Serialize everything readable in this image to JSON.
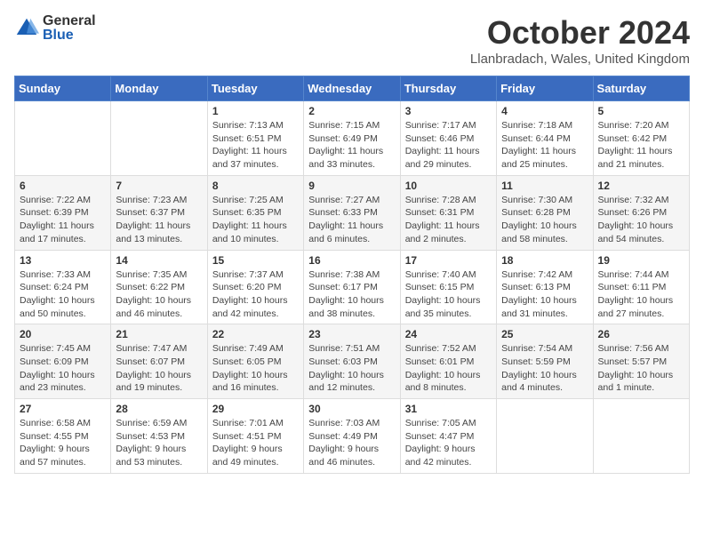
{
  "logo": {
    "general": "General",
    "blue": "Blue"
  },
  "header": {
    "month": "October 2024",
    "location": "Llanbradach, Wales, United Kingdom"
  },
  "weekdays": [
    "Sunday",
    "Monday",
    "Tuesday",
    "Wednesday",
    "Thursday",
    "Friday",
    "Saturday"
  ],
  "weeks": [
    [
      {
        "day": "",
        "sunrise": "",
        "sunset": "",
        "daylight": ""
      },
      {
        "day": "",
        "sunrise": "",
        "sunset": "",
        "daylight": ""
      },
      {
        "day": "1",
        "sunrise": "Sunrise: 7:13 AM",
        "sunset": "Sunset: 6:51 PM",
        "daylight": "Daylight: 11 hours and 37 minutes."
      },
      {
        "day": "2",
        "sunrise": "Sunrise: 7:15 AM",
        "sunset": "Sunset: 6:49 PM",
        "daylight": "Daylight: 11 hours and 33 minutes."
      },
      {
        "day": "3",
        "sunrise": "Sunrise: 7:17 AM",
        "sunset": "Sunset: 6:46 PM",
        "daylight": "Daylight: 11 hours and 29 minutes."
      },
      {
        "day": "4",
        "sunrise": "Sunrise: 7:18 AM",
        "sunset": "Sunset: 6:44 PM",
        "daylight": "Daylight: 11 hours and 25 minutes."
      },
      {
        "day": "5",
        "sunrise": "Sunrise: 7:20 AM",
        "sunset": "Sunset: 6:42 PM",
        "daylight": "Daylight: 11 hours and 21 minutes."
      }
    ],
    [
      {
        "day": "6",
        "sunrise": "Sunrise: 7:22 AM",
        "sunset": "Sunset: 6:39 PM",
        "daylight": "Daylight: 11 hours and 17 minutes."
      },
      {
        "day": "7",
        "sunrise": "Sunrise: 7:23 AM",
        "sunset": "Sunset: 6:37 PM",
        "daylight": "Daylight: 11 hours and 13 minutes."
      },
      {
        "day": "8",
        "sunrise": "Sunrise: 7:25 AM",
        "sunset": "Sunset: 6:35 PM",
        "daylight": "Daylight: 11 hours and 10 minutes."
      },
      {
        "day": "9",
        "sunrise": "Sunrise: 7:27 AM",
        "sunset": "Sunset: 6:33 PM",
        "daylight": "Daylight: 11 hours and 6 minutes."
      },
      {
        "day": "10",
        "sunrise": "Sunrise: 7:28 AM",
        "sunset": "Sunset: 6:31 PM",
        "daylight": "Daylight: 11 hours and 2 minutes."
      },
      {
        "day": "11",
        "sunrise": "Sunrise: 7:30 AM",
        "sunset": "Sunset: 6:28 PM",
        "daylight": "Daylight: 10 hours and 58 minutes."
      },
      {
        "day": "12",
        "sunrise": "Sunrise: 7:32 AM",
        "sunset": "Sunset: 6:26 PM",
        "daylight": "Daylight: 10 hours and 54 minutes."
      }
    ],
    [
      {
        "day": "13",
        "sunrise": "Sunrise: 7:33 AM",
        "sunset": "Sunset: 6:24 PM",
        "daylight": "Daylight: 10 hours and 50 minutes."
      },
      {
        "day": "14",
        "sunrise": "Sunrise: 7:35 AM",
        "sunset": "Sunset: 6:22 PM",
        "daylight": "Daylight: 10 hours and 46 minutes."
      },
      {
        "day": "15",
        "sunrise": "Sunrise: 7:37 AM",
        "sunset": "Sunset: 6:20 PM",
        "daylight": "Daylight: 10 hours and 42 minutes."
      },
      {
        "day": "16",
        "sunrise": "Sunrise: 7:38 AM",
        "sunset": "Sunset: 6:17 PM",
        "daylight": "Daylight: 10 hours and 38 minutes."
      },
      {
        "day": "17",
        "sunrise": "Sunrise: 7:40 AM",
        "sunset": "Sunset: 6:15 PM",
        "daylight": "Daylight: 10 hours and 35 minutes."
      },
      {
        "day": "18",
        "sunrise": "Sunrise: 7:42 AM",
        "sunset": "Sunset: 6:13 PM",
        "daylight": "Daylight: 10 hours and 31 minutes."
      },
      {
        "day": "19",
        "sunrise": "Sunrise: 7:44 AM",
        "sunset": "Sunset: 6:11 PM",
        "daylight": "Daylight: 10 hours and 27 minutes."
      }
    ],
    [
      {
        "day": "20",
        "sunrise": "Sunrise: 7:45 AM",
        "sunset": "Sunset: 6:09 PM",
        "daylight": "Daylight: 10 hours and 23 minutes."
      },
      {
        "day": "21",
        "sunrise": "Sunrise: 7:47 AM",
        "sunset": "Sunset: 6:07 PM",
        "daylight": "Daylight: 10 hours and 19 minutes."
      },
      {
        "day": "22",
        "sunrise": "Sunrise: 7:49 AM",
        "sunset": "Sunset: 6:05 PM",
        "daylight": "Daylight: 10 hours and 16 minutes."
      },
      {
        "day": "23",
        "sunrise": "Sunrise: 7:51 AM",
        "sunset": "Sunset: 6:03 PM",
        "daylight": "Daylight: 10 hours and 12 minutes."
      },
      {
        "day": "24",
        "sunrise": "Sunrise: 7:52 AM",
        "sunset": "Sunset: 6:01 PM",
        "daylight": "Daylight: 10 hours and 8 minutes."
      },
      {
        "day": "25",
        "sunrise": "Sunrise: 7:54 AM",
        "sunset": "Sunset: 5:59 PM",
        "daylight": "Daylight: 10 hours and 4 minutes."
      },
      {
        "day": "26",
        "sunrise": "Sunrise: 7:56 AM",
        "sunset": "Sunset: 5:57 PM",
        "daylight": "Daylight: 10 hours and 1 minute."
      }
    ],
    [
      {
        "day": "27",
        "sunrise": "Sunrise: 6:58 AM",
        "sunset": "Sunset: 4:55 PM",
        "daylight": "Daylight: 9 hours and 57 minutes."
      },
      {
        "day": "28",
        "sunrise": "Sunrise: 6:59 AM",
        "sunset": "Sunset: 4:53 PM",
        "daylight": "Daylight: 9 hours and 53 minutes."
      },
      {
        "day": "29",
        "sunrise": "Sunrise: 7:01 AM",
        "sunset": "Sunset: 4:51 PM",
        "daylight": "Daylight: 9 hours and 49 minutes."
      },
      {
        "day": "30",
        "sunrise": "Sunrise: 7:03 AM",
        "sunset": "Sunset: 4:49 PM",
        "daylight": "Daylight: 9 hours and 46 minutes."
      },
      {
        "day": "31",
        "sunrise": "Sunrise: 7:05 AM",
        "sunset": "Sunset: 4:47 PM",
        "daylight": "Daylight: 9 hours and 42 minutes."
      },
      {
        "day": "",
        "sunrise": "",
        "sunset": "",
        "daylight": ""
      },
      {
        "day": "",
        "sunrise": "",
        "sunset": "",
        "daylight": ""
      }
    ]
  ]
}
